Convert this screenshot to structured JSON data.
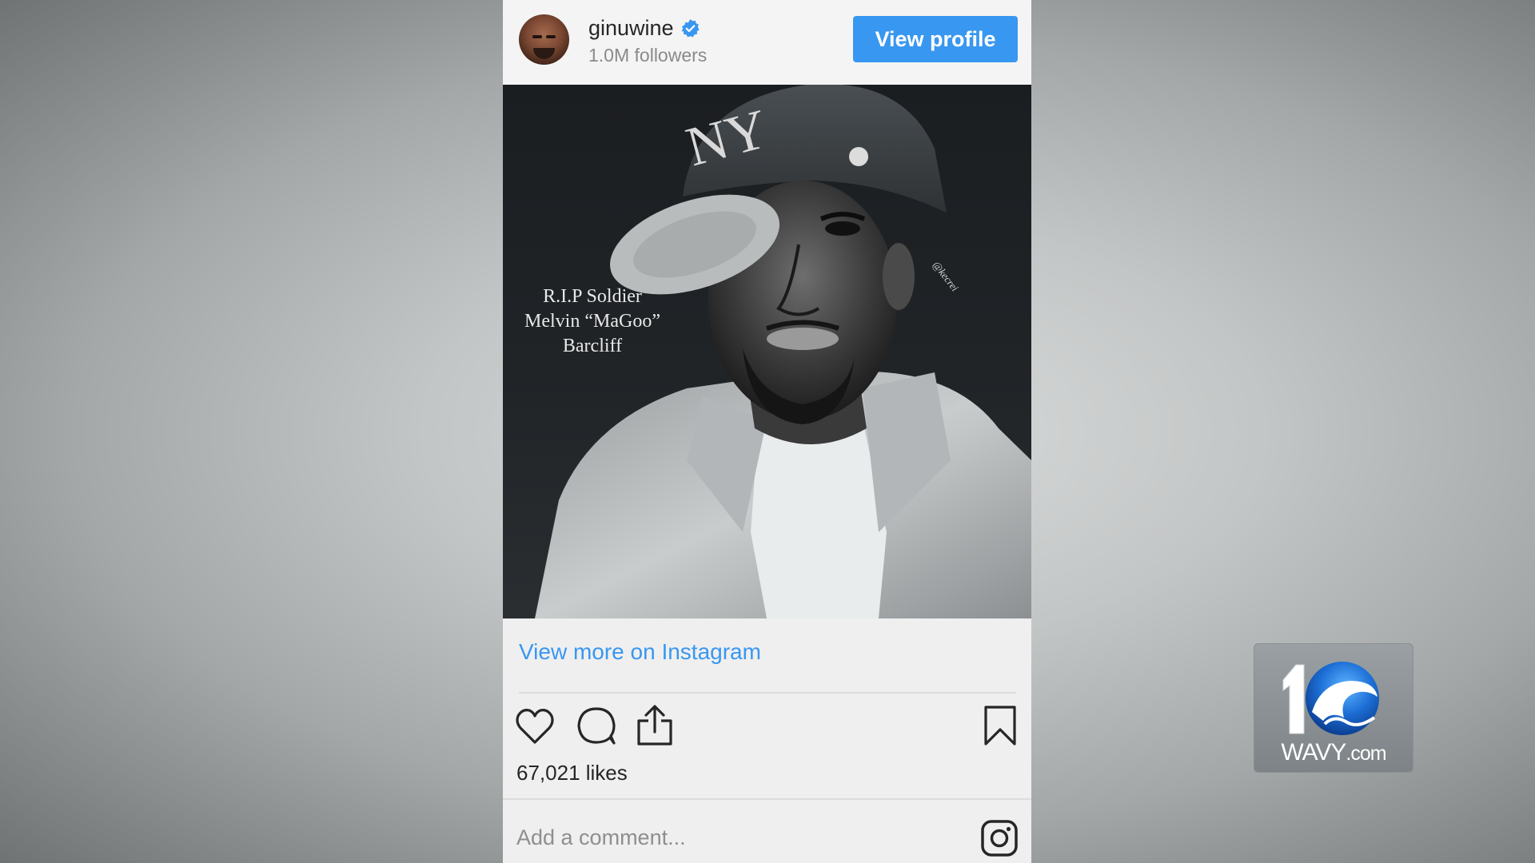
{
  "post": {
    "username": "ginuwine",
    "followers": "1.0M followers",
    "view_profile_label": "View profile",
    "image_caption": {
      "line1": "R.I.P Soldier",
      "line2": "Melvin “MaGoo”",
      "line3": "Barcliff"
    },
    "image_watermark": "@kecrei",
    "view_more_label": "View more on Instagram",
    "likes": "67,021 likes",
    "comment_placeholder": "Add a comment..."
  },
  "icons": {
    "verified": "verified-badge-icon",
    "like": "heart-icon",
    "comment": "comment-bubble-icon",
    "share": "share-icon",
    "save": "bookmark-icon",
    "instagram": "instagram-logo-icon"
  },
  "station_logo": {
    "number": "10",
    "brand": "WAVY",
    "suffix": ".com"
  },
  "colors": {
    "accent": "#3897f0",
    "card_bg": "#efefef",
    "text_dark": "#262626",
    "text_muted": "#8e8e8e"
  }
}
